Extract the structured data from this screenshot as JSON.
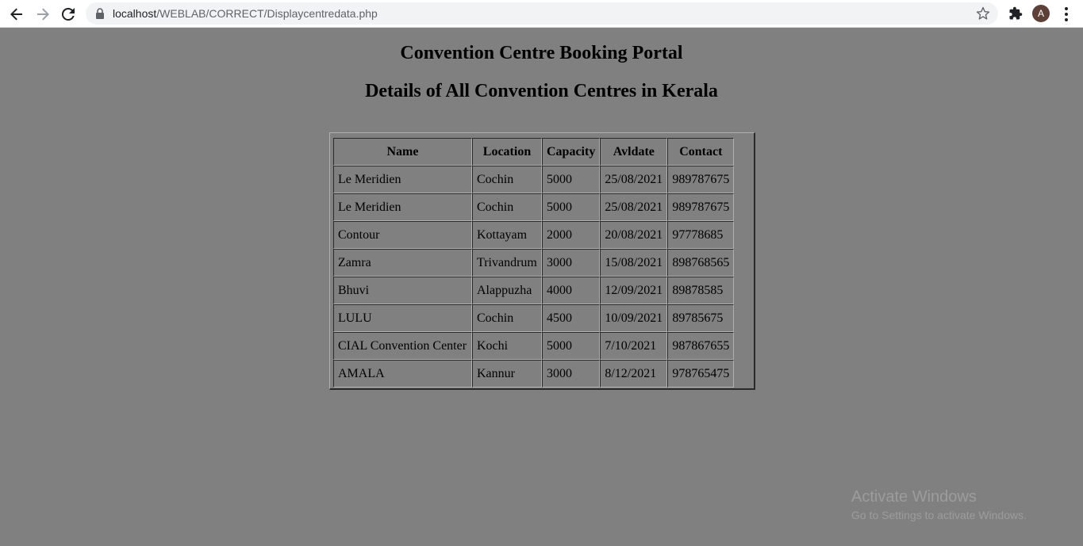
{
  "browser": {
    "url_host": "localhost",
    "url_path": "/WEBLAB/CORRECT/Displaycentredata.php",
    "avatar_letter": "A",
    "icons": [
      "back-arrow-icon",
      "forward-arrow-icon",
      "reload-icon",
      "lock-icon",
      "star-icon",
      "puzzle-icon",
      "kebab-menu-icon"
    ]
  },
  "page": {
    "title": "Convention Centre Booking Portal",
    "subtitle": "Details of All Convention Centres in Kerala",
    "background": "#808080"
  },
  "table": {
    "headers": [
      "Name",
      "Location",
      "Capacity",
      "Avldate",
      "Contact"
    ],
    "rows": [
      [
        "Le Meridien",
        "Cochin",
        "5000",
        "25/08/2021",
        "989787675"
      ],
      [
        "Le Meridien",
        "Cochin",
        "5000",
        "25/08/2021",
        "989787675"
      ],
      [
        "Contour",
        "Kottayam",
        "2000",
        "20/08/2021",
        "97778685"
      ],
      [
        "Zamra",
        "Trivandrum",
        "3000",
        "15/08/2021",
        "898768565"
      ],
      [
        "Bhuvi",
        "Alappuzha",
        "4000",
        "12/09/2021",
        "89878585"
      ],
      [
        "LULU",
        "Cochin",
        "4500",
        "10/09/2021",
        "89785675"
      ],
      [
        "CIAL Convention Center",
        "Kochi",
        "5000",
        "7/10/2021",
        "987867655"
      ],
      [
        "AMALA",
        "Kannur",
        "3000",
        "8/12/2021",
        "978765475"
      ]
    ]
  },
  "watermark": {
    "line1": "Activate Windows",
    "line2": "Go to Settings to activate Windows."
  }
}
